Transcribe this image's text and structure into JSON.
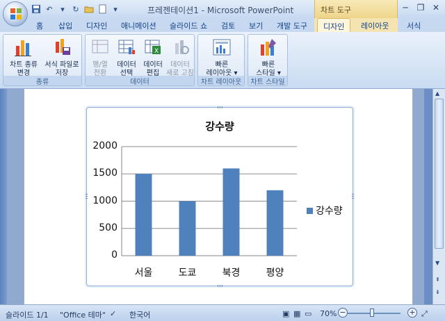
{
  "window": {
    "title": "프레젠테이션1 - Microsoft PowerPoint",
    "context_title": "차트 도구"
  },
  "tabs": [
    "홈",
    "삽입",
    "디자인",
    "애니메이션",
    "슬라이드 쇼",
    "검토",
    "보기",
    "개발 도구",
    "디자인",
    "레이아웃",
    "서식"
  ],
  "active_tab_index": 8,
  "ribbon": {
    "groups": [
      {
        "label": "종류",
        "buttons": [
          {
            "line1": "차트 종류",
            "line2": "변경"
          },
          {
            "line1": "서식 파일로",
            "line2": "저장"
          }
        ]
      },
      {
        "label": "데이터",
        "buttons": [
          {
            "line1": "행/열",
            "line2": "전환"
          },
          {
            "line1": "데이터",
            "line2": "선택"
          },
          {
            "line1": "데이터",
            "line2": "편집"
          },
          {
            "line1": "데이터",
            "line2": "새로 고침"
          }
        ]
      },
      {
        "label": "차트 레이아웃",
        "buttons": [
          {
            "line1": "빠른",
            "line2": "레이아웃 ▾"
          }
        ]
      },
      {
        "label": "차트 스타일",
        "buttons": [
          {
            "line1": "빠른",
            "line2": "스타일 ▾"
          }
        ]
      }
    ]
  },
  "chart_data": {
    "type": "bar",
    "title": "강수량",
    "categories": [
      "서울",
      "도쿄",
      "북경",
      "평양"
    ],
    "series": [
      {
        "name": "강수량",
        "values": [
          1500,
          1000,
          1600,
          1200
        ],
        "color": "#4f81bd"
      }
    ],
    "yticks": [
      "0",
      "500",
      "1000",
      "1500",
      "2000"
    ],
    "ylim": [
      0,
      2000
    ],
    "grid": true,
    "legend": "right"
  },
  "statusbar": {
    "slide": "슬라이드 1/1",
    "theme": "\"Office 테마\"",
    "language": "한국어",
    "zoom": "70%"
  }
}
